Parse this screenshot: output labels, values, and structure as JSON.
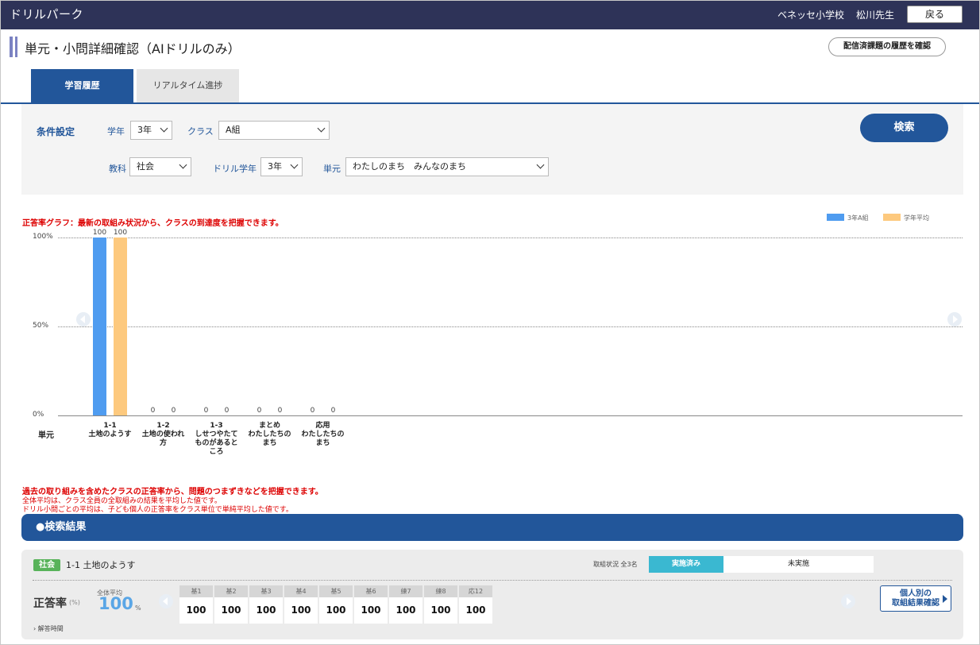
{
  "header": {
    "app_title": "ドリルパーク",
    "school": "ベネッセ小学校",
    "teacher": "松川先生",
    "back_label": "戻る"
  },
  "page": {
    "title": "単元・小問詳細確認（AIドリルのみ）",
    "history_button": "配信済課題の履歴を確認"
  },
  "tabs": [
    {
      "label": "学習履歴",
      "active": true
    },
    {
      "label": "リアルタイム進捗",
      "active": false
    }
  ],
  "filter": {
    "section_label": "条件設定",
    "grade_label": "学年",
    "grade_value": "3年",
    "class_label": "クラス",
    "class_value": "A組",
    "subject_label": "教科",
    "subject_value": "社会",
    "drill_grade_label": "ドリル学年",
    "drill_grade_value": "3年",
    "unit_label": "単元",
    "unit_value": "わたしのまち　みんなのまち",
    "search_label": "検索"
  },
  "chart_note": "正答率グラフ：最新の取組み状況から、クラスの到達度を把握できます。",
  "chart_data": {
    "type": "bar",
    "categories": [
      "1-1\n土地のようす",
      "1-2\n土地の使われ\n方",
      "1-3\nしせつやたて\nものがあると\nころ",
      "まとめ\nわたしたちの\nまち",
      "応用\nわたしたちの\nまち"
    ],
    "series": [
      {
        "name": "3年A組",
        "values": [
          100,
          0,
          0,
          0,
          0
        ],
        "color": "#4f9cf0"
      },
      {
        "name": "学年平均",
        "values": [
          100,
          0,
          0,
          0,
          0
        ],
        "color": "#fdc97e"
      }
    ],
    "yticks": [
      "0%",
      "50%",
      "100%"
    ],
    "ylim": [
      0,
      100
    ],
    "xlabel": "単元",
    "legend": "top-right",
    "grid": true
  },
  "notes": {
    "main": "過去の取り組みを含めたクラスの正答率から、問題のつまずきなどを把握できます。",
    "sub1": "全体平均は、クラス全員の全取組みの結果を平均した値です。",
    "sub2": "ドリル小問ごとの平均は、子ども個人の正答率をクラス単位で単純平均した値です。"
  },
  "results": {
    "header": "●検索結果",
    "subject_badge": "社会",
    "unit_name": "1-1 土地のようす",
    "status_label": "取組状況 全3名",
    "status_done": "実施済み",
    "status_not": "未実施",
    "rate_label": "正答率",
    "rate_unit": "(%)",
    "avg_label": "全体平均",
    "avg_value": "100",
    "avg_pct": "%",
    "cells": [
      {
        "head": "基1",
        "val": "100"
      },
      {
        "head": "基2",
        "val": "100"
      },
      {
        "head": "基3",
        "val": "100"
      },
      {
        "head": "基4",
        "val": "100"
      },
      {
        "head": "基5",
        "val": "100"
      },
      {
        "head": "基6",
        "val": "100"
      },
      {
        "head": "練7",
        "val": "100"
      },
      {
        "head": "練8",
        "val": "100"
      },
      {
        "head": "応12",
        "val": "100"
      }
    ],
    "detail_button": "個人別の\n取組結果確認",
    "answer_time": "解答時間"
  }
}
